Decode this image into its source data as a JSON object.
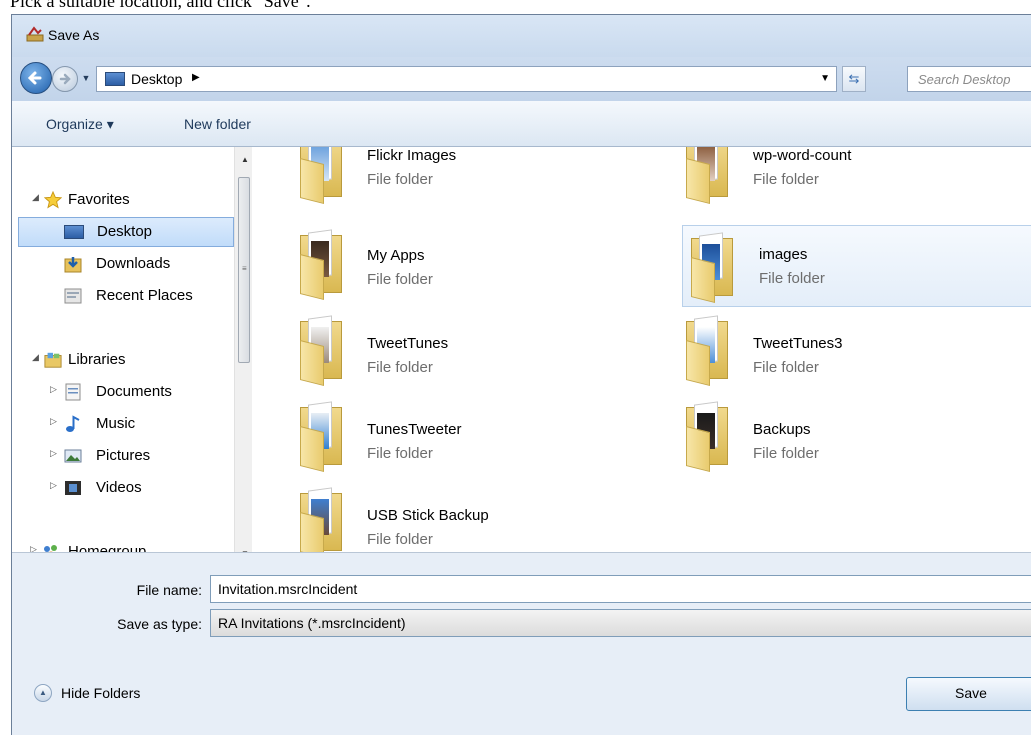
{
  "caption": "Pick a suitable location, and click \"Save\".",
  "window": {
    "title": "Save As"
  },
  "nav": {
    "address_segment": "Desktop",
    "search_placeholder": "Search Desktop"
  },
  "toolbar": {
    "organize_label": "Organize ▾",
    "new_folder_label": "New folder"
  },
  "sidebar": {
    "favorites": {
      "label": "Favorites",
      "items": [
        {
          "label": "Desktop",
          "icon": "desktop-icon"
        },
        {
          "label": "Downloads",
          "icon": "downloads-icon"
        },
        {
          "label": "Recent Places",
          "icon": "recent-places-icon"
        }
      ]
    },
    "libraries": {
      "label": "Libraries",
      "items": [
        {
          "label": "Documents",
          "icon": "documents-icon"
        },
        {
          "label": "Music",
          "icon": "music-icon"
        },
        {
          "label": "Pictures",
          "icon": "pictures-icon"
        },
        {
          "label": "Videos",
          "icon": "videos-icon"
        }
      ]
    },
    "homegroup": {
      "label": "Homegroup"
    }
  },
  "files": [
    {
      "name": "Flickr Images",
      "type": "File folder"
    },
    {
      "name": "wp-word-count",
      "type": "File folder"
    },
    {
      "name": "My Apps",
      "type": "File folder"
    },
    {
      "name": "images",
      "type": "File folder",
      "selected": true
    },
    {
      "name": "TweetTunes",
      "type": "File folder"
    },
    {
      "name": "TweetTunes3",
      "type": "File folder"
    },
    {
      "name": "TunesTweeter",
      "type": "File folder"
    },
    {
      "name": "Backups",
      "type": "File folder"
    },
    {
      "name": "USB Stick Backup",
      "type": "File folder"
    }
  ],
  "form": {
    "file_name_label": "File name:",
    "file_name_value": "Invitation.msrcIncident",
    "save_type_label": "Save as type:",
    "save_type_value": "RA Invitations (*.msrcIncident)"
  },
  "footer": {
    "hide_folders_label": "Hide Folders",
    "save_label": "Save"
  },
  "colors": {
    "accent": "#1f5fab",
    "selection": "#c1dcfa",
    "folder": "#e9cb6e"
  }
}
